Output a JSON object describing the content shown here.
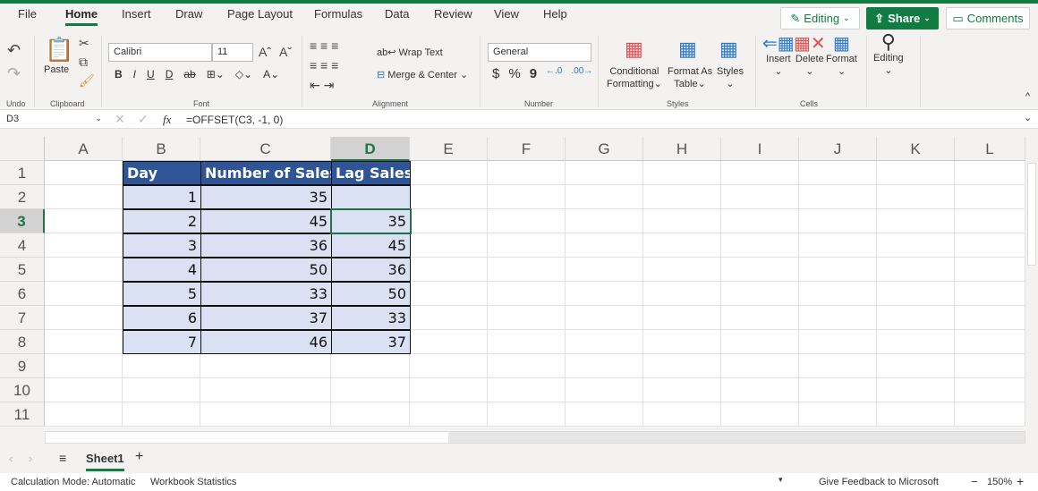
{
  "tabs": [
    "File",
    "Home",
    "Insert",
    "Draw",
    "Page Layout",
    "Formulas",
    "Data",
    "Review",
    "View",
    "Help"
  ],
  "active_tab": "Home",
  "top_buttons": {
    "editing": "Editing",
    "share": "Share",
    "comments": "Comments"
  },
  "ribbon": {
    "undo_group": "Undo",
    "clipboard_group": "Clipboard",
    "paste": "Paste",
    "font_name": "Calibri",
    "font_size": "11",
    "font_group": "Font",
    "bold": "B",
    "italic": "I",
    "underline": "U",
    "double_underline": "D",
    "strike": "ab",
    "wrap_text": "Wrap Text",
    "merge_center": "Merge & Center",
    "alignment_group": "Alignment",
    "number_format": "General",
    "number_group": "Number",
    "currency": "$",
    "percent": "%",
    "comma": "9",
    "conditional_1": "Conditional",
    "conditional_2": "Formatting",
    "format_table_1": "Format As",
    "format_table_2": "Table",
    "styles": "Styles",
    "styles_group": "Styles",
    "insert": "Insert",
    "delete": "Delete",
    "format": "Format",
    "cells_group": "Cells",
    "editing": "Editing"
  },
  "formula_bar": {
    "name_box": "D3",
    "fx": "fx",
    "formula": "=OFFSET(C3, -1, 0)"
  },
  "columns": [
    "A",
    "B",
    "C",
    "D",
    "E",
    "F",
    "G",
    "H",
    "I",
    "J",
    "K",
    "L"
  ],
  "rows": [
    "1",
    "2",
    "3",
    "4",
    "5",
    "6",
    "7",
    "8",
    "9",
    "10",
    "11"
  ],
  "selected_cell": "D3",
  "table": {
    "headers": [
      "Day",
      "Number of Sales",
      "Lag Sales"
    ],
    "data": [
      [
        "1",
        "35",
        ""
      ],
      [
        "2",
        "45",
        "35"
      ],
      [
        "3",
        "36",
        "45"
      ],
      [
        "4",
        "50",
        "36"
      ],
      [
        "5",
        "33",
        "50"
      ],
      [
        "6",
        "37",
        "33"
      ],
      [
        "7",
        "46",
        "37"
      ]
    ]
  },
  "sheets": [
    "Sheet1"
  ],
  "status": {
    "calc_mode": "Calculation Mode: Automatic",
    "workbook_stats": "Workbook Statistics",
    "feedback": "Give Feedback to Microsoft",
    "zoom": "150%"
  },
  "colors": {
    "accent": "#107c41",
    "header_fill": "#2f5597",
    "data_fill": "#d9e1f2"
  }
}
